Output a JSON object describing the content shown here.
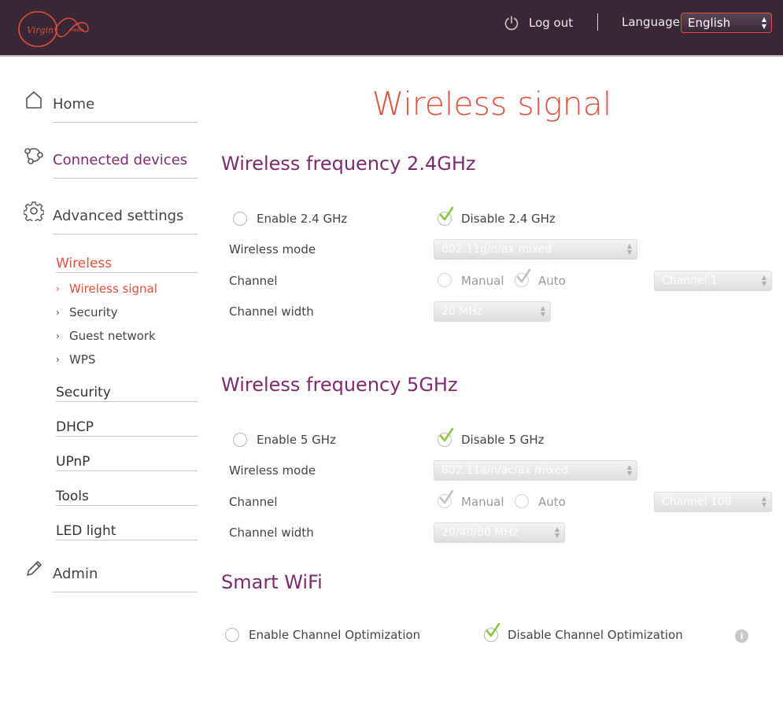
{
  "header": {
    "logo_text": "Virgin media",
    "logout_label": "Log out",
    "language_label": "Language",
    "language_value": "English"
  },
  "colors": {
    "header_bg": "#3a2736",
    "accent_red": "#e0513b",
    "accent_purple": "#7d2a6e",
    "check_green": "#8cc63f"
  },
  "sidebar": {
    "home": "Home",
    "connected_devices": "Connected devices",
    "advanced_settings": "Advanced settings",
    "admin": "Admin",
    "wireless": "Wireless",
    "wireless_items": [
      "Wireless signal",
      "Security",
      "Guest network",
      "WPS"
    ],
    "sections": [
      "Security",
      "DHCP",
      "UPnP",
      "Tools",
      "LED light"
    ]
  },
  "main": {
    "title": "Wireless signal",
    "band24": {
      "title": "Wireless frequency 2.4GHz",
      "enable_label": "Enable 2.4 GHz",
      "disable_label": "Disable 2.4 GHz",
      "selected": "disable",
      "mode_label": "Wireless mode",
      "mode_value": "802.11g/n/ax mixed",
      "channel_label": "Channel",
      "manual_label": "Manual",
      "auto_label": "Auto",
      "channel_selected": "auto",
      "channel_value": "Channel 1",
      "width_label": "Channel width",
      "width_value": "20 MHz"
    },
    "band5": {
      "title": "Wireless frequency 5GHz",
      "enable_label": "Enable 5 GHz",
      "disable_label": "Disable 5 GHz",
      "selected": "disable",
      "mode_label": "Wireless mode",
      "mode_value": "802.11a/n/ac/ax mixed",
      "channel_label": "Channel",
      "manual_label": "Manual",
      "auto_label": "Auto",
      "channel_selected": "manual",
      "channel_value": "Channel 108",
      "width_label": "Channel width",
      "width_value": "20/40/80 MHz"
    },
    "smart_wifi": {
      "title": "Smart WiFi",
      "enable_label": "Enable Channel Optimization",
      "disable_label": "Disable Channel Optimization",
      "selected": "disable",
      "info_glyph": "i"
    }
  }
}
